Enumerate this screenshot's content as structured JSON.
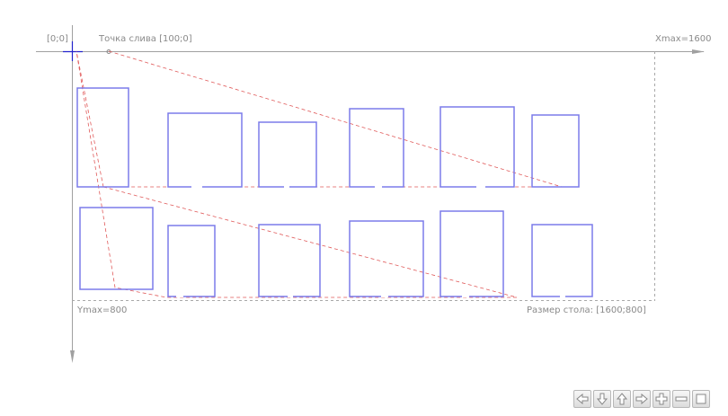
{
  "labels": {
    "origin": "[0;0]",
    "drain_point": "Точка слива [100;0]",
    "xmax": "Xmax=1600",
    "ymax": "Ymax=800",
    "table_size": "Размер стола: [1600;800]"
  },
  "colors": {
    "axis": "#a0a0a0",
    "table_border": "#a8a8a8",
    "part": "#7b7bea",
    "path": "#e05a5a",
    "origin_marker": "#2222cc"
  },
  "toolbar": {
    "buttons": [
      {
        "name": "arrow-left-icon"
      },
      {
        "name": "arrow-down-icon"
      },
      {
        "name": "arrow-up-icon"
      },
      {
        "name": "arrow-right-icon"
      },
      {
        "name": "plus-icon"
      },
      {
        "name": "minus-icon"
      },
      {
        "name": "square-icon"
      }
    ]
  }
}
